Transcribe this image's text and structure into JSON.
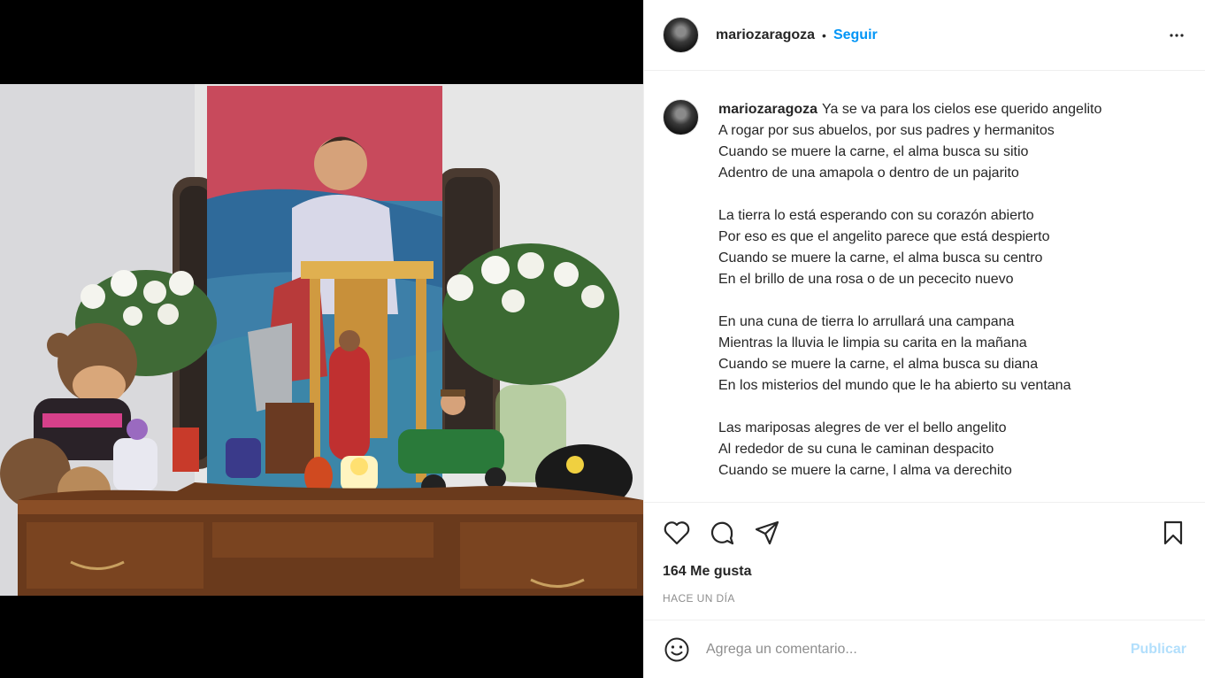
{
  "post": {
    "username": "mariozaragoza",
    "follow_label": "Seguir",
    "separator": "•",
    "more_label": "more-options-icon"
  },
  "caption": {
    "username": "mariozaragoza",
    "lines": [
      "Ya se va para los cielos ese querido angelito",
      "A rogar por sus abuelos, por sus padres y hermanitos",
      "Cuando se muere la carne, el alma busca su sitio",
      "Adentro de una amapola o dentro de un pajarito",
      "",
      "La tierra lo está esperando con su corazón abierto",
      "Por eso es que el angelito parece que está despierto",
      "Cuando se muere la carne, el alma busca su centro",
      "En el brillo de una rosa o de un pececito nuevo",
      "",
      "En una cuna de tierra lo arrullará una campana",
      "Mientras la lluvia le limpia su carita en la mañana",
      "Cuando se muere la carne, el alma busca su diana",
      "En los misterios del mundo que le ha abierto su ventana",
      "",
      "Las mariposas alegres de ver el bello angelito",
      "Al rededor de su cuna le caminan despacito",
      "Cuando se muere la carne, l alma va derechito"
    ]
  },
  "stats": {
    "likes": "164 Me gusta",
    "time": "HACE UN DÍA"
  },
  "comment": {
    "placeholder": "Agrega un comentario...",
    "publish_label": "Publicar"
  },
  "icons": {
    "like": "heart-icon",
    "comment": "comment-bubble-icon",
    "share": "paper-plane-icon",
    "save": "bookmark-icon",
    "emoji": "smiley-icon"
  },
  "colors": {
    "link_blue": "#0095f6",
    "publish_disabled": "#b2dffc",
    "muted": "#8e8e8e",
    "text": "#262626"
  }
}
